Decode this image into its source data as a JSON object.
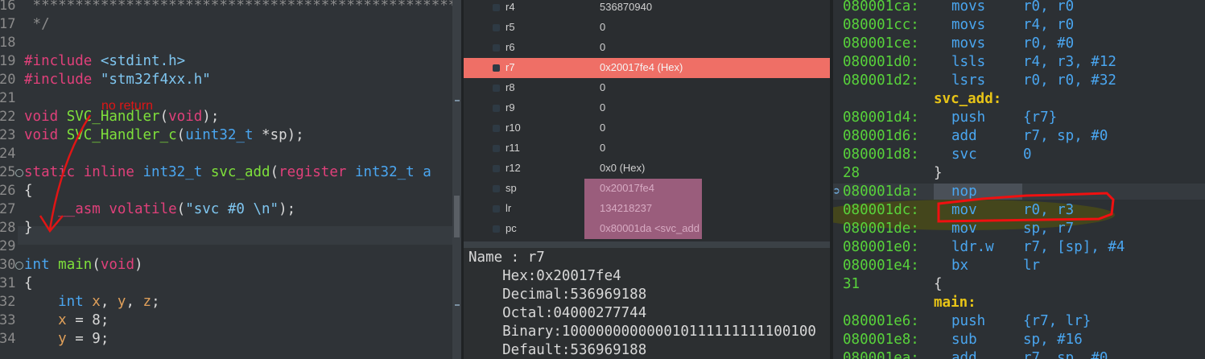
{
  "editor": {
    "lines": [
      {
        "no": "16",
        "text": " *******************************************************"
      },
      {
        "no": "17",
        "text": " */"
      },
      {
        "no": "18",
        "text": ""
      },
      {
        "no": "19",
        "parts": [
          [
            "kw-inc",
            "#include "
          ],
          [
            "str",
            "<stdint.h>"
          ]
        ]
      },
      {
        "no": "20",
        "parts": [
          [
            "kw-inc",
            "#include "
          ],
          [
            "str",
            "\"stm32f4xx.h\""
          ]
        ]
      },
      {
        "no": "21",
        "text": ""
      },
      {
        "no": "22",
        "parts": [
          [
            "kw",
            "void "
          ],
          [
            "fn",
            "SVC_Handler"
          ],
          [
            "punct",
            "("
          ],
          [
            "kw",
            "void"
          ],
          [
            "punct",
            ");"
          ]
        ]
      },
      {
        "no": "23",
        "parts": [
          [
            "kw",
            "void "
          ],
          [
            "fn",
            "SVC_Handler_c"
          ],
          [
            "punct",
            "("
          ],
          [
            "ty",
            "uint32_t"
          ],
          [
            "punct",
            " *sp);"
          ]
        ]
      },
      {
        "no": "24",
        "text": ""
      },
      {
        "no": "25",
        "parts": [
          [
            "kw",
            "static inline "
          ],
          [
            "ty",
            "int32_t "
          ],
          [
            "fn",
            "svc_add"
          ],
          [
            "punct",
            "("
          ],
          [
            "kw",
            "register "
          ],
          [
            "ty",
            "int32_t a"
          ]
        ]
      },
      {
        "no": "26",
        "parts": [
          [
            "punct",
            "{"
          ]
        ]
      },
      {
        "no": "27",
        "parts": [
          [
            "kw",
            "    __asm volatile"
          ],
          [
            "punct",
            "("
          ],
          [
            "str",
            "\"svc #0 \\n\""
          ],
          [
            "punct",
            ");"
          ]
        ]
      },
      {
        "no": "28",
        "parts": [
          [
            "punct",
            "}"
          ]
        ]
      },
      {
        "no": "29",
        "text": ""
      },
      {
        "no": "30",
        "parts": [
          [
            "ty",
            "int "
          ],
          [
            "fn",
            "main"
          ],
          [
            "punct",
            "("
          ],
          [
            "kw",
            "void"
          ],
          [
            "punct",
            ")"
          ]
        ]
      },
      {
        "no": "31",
        "parts": [
          [
            "punct",
            "{"
          ]
        ]
      },
      {
        "no": "32",
        "parts": [
          [
            "ty",
            "    int "
          ],
          [
            "var",
            "x"
          ],
          [
            "punct",
            ", "
          ],
          [
            "var",
            "y"
          ],
          [
            "punct",
            ", "
          ],
          [
            "var",
            "z"
          ],
          [
            "punct",
            ";"
          ]
        ]
      },
      {
        "no": "33",
        "parts": [
          [
            "var",
            "    x"
          ],
          [
            "punct",
            " = 8;"
          ]
        ]
      },
      {
        "no": "34",
        "parts": [
          [
            "var",
            "    y"
          ],
          [
            "punct",
            " = 9;"
          ]
        ]
      }
    ],
    "annotation": "no return"
  },
  "registers": {
    "rows": [
      {
        "name": "r4",
        "value": "536870940",
        "style": "normal"
      },
      {
        "name": "r5",
        "value": "0",
        "style": "normal"
      },
      {
        "name": "r6",
        "value": "0",
        "style": "normal"
      },
      {
        "name": "r7",
        "value": "0x20017fe4 (Hex)",
        "style": "changed"
      },
      {
        "name": "r8",
        "value": "0",
        "style": "normal"
      },
      {
        "name": "r9",
        "value": "0",
        "style": "normal"
      },
      {
        "name": "r10",
        "value": "0",
        "style": "normal"
      },
      {
        "name": "r11",
        "value": "0",
        "style": "normal"
      },
      {
        "name": "r12",
        "value": "0x0 (Hex)",
        "style": "normal"
      },
      {
        "name": "sp",
        "value": "0x20017fe4",
        "style": "pink"
      },
      {
        "name": "lr",
        "value": "134218237",
        "style": "pink"
      },
      {
        "name": "pc",
        "value": "0x80001da <svc_add",
        "style": "pink"
      }
    ],
    "details": {
      "name": "Name : r7",
      "hex": "    Hex:0x20017fe4",
      "decimal": "    Decimal:536969188",
      "octal": "    Octal:04000277744",
      "binary": "    Binary:100000000000010111111111100100",
      "default": "    Default:536969188"
    }
  },
  "disassembly": {
    "lines": [
      {
        "kind": "ins",
        "addr": "080001ca:",
        "mn": "movs",
        "ops": "r0, r0"
      },
      {
        "kind": "ins",
        "addr": "080001cc:",
        "mn": "movs",
        "ops": "r4, r0"
      },
      {
        "kind": "ins",
        "addr": "080001ce:",
        "mn": "movs",
        "ops": "r0, #0"
      },
      {
        "kind": "ins",
        "addr": "080001d0:",
        "mn": "lsls",
        "ops": "r4, r3, #12"
      },
      {
        "kind": "ins",
        "addr": "080001d2:",
        "mn": "lsrs",
        "ops": "r0, r0, #32"
      },
      {
        "kind": "label",
        "text": "svc_add:"
      },
      {
        "kind": "ins",
        "addr": "080001d4:",
        "mn": "push",
        "ops": "{r7}"
      },
      {
        "kind": "ins",
        "addr": "080001d6:",
        "mn": "add",
        "ops": "r7, sp, #0"
      },
      {
        "kind": "ins",
        "addr": "080001d8:",
        "mn": "svc",
        "ops": "0"
      },
      {
        "kind": "src",
        "no": "28",
        "text": "}"
      },
      {
        "kind": "ins",
        "addr": "080001da:",
        "mn": "nop",
        "ops": ""
      },
      {
        "kind": "ins",
        "addr": "080001dc:",
        "mn": "mov",
        "ops": "r0, r3"
      },
      {
        "kind": "ins",
        "addr": "080001de:",
        "mn": "mov",
        "ops": "sp, r7"
      },
      {
        "kind": "ins",
        "addr": "080001e0:",
        "mn": "ldr.w",
        "ops": "r7, [sp], #4"
      },
      {
        "kind": "ins",
        "addr": "080001e4:",
        "mn": "bx",
        "ops": "lr"
      },
      {
        "kind": "src",
        "no": "31",
        "text": "{"
      },
      {
        "kind": "label",
        "text": "main:"
      },
      {
        "kind": "ins",
        "addr": "080001e6:",
        "mn": "push",
        "ops": "{r7, lr}"
      },
      {
        "kind": "ins",
        "addr": "080001e8:",
        "mn": "sub",
        "ops": "sp, #16"
      },
      {
        "kind": "ins",
        "addr": "080001ea:",
        "mn": "add",
        "ops": "r7, sp, #0"
      }
    ]
  },
  "colors": {
    "changed_row": "#ef6f66",
    "annotation": "#e01515",
    "address": "#58d23b",
    "label": "#e8c417"
  }
}
